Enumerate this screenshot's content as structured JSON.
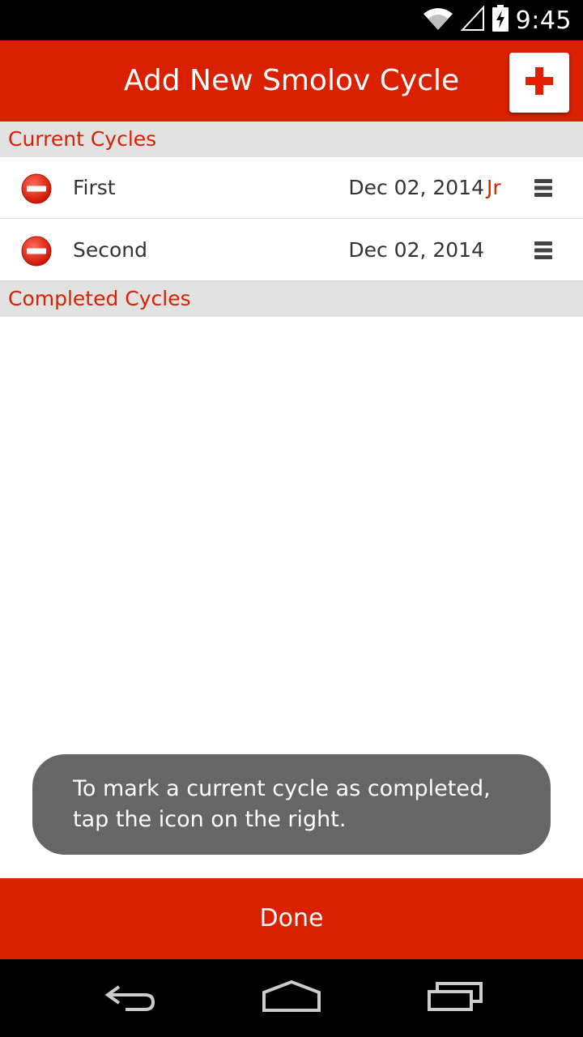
{
  "status_bar": {
    "time": "9:45",
    "icons": [
      "wifi-icon",
      "signal-icon",
      "battery-charging-icon"
    ]
  },
  "action_bar": {
    "title": "Add New Smolov Cycle",
    "add_button_icon": "red-plus-icon",
    "accent_color": "#d92100"
  },
  "sections": {
    "current_title": "Current Cycles",
    "completed_title": "Completed Cycles"
  },
  "current_cycles": [
    {
      "name": "First",
      "date": "Dec 02, 2014",
      "tag": "Jr"
    },
    {
      "name": "Second",
      "date": "Dec 02, 2014",
      "tag": ""
    }
  ],
  "toast": {
    "message": "To mark a current cycle as completed, tap the icon on the right."
  },
  "done_button": {
    "label": "Done"
  },
  "nav_bar": {
    "icons": [
      "back-icon",
      "home-icon",
      "recents-icon"
    ]
  }
}
